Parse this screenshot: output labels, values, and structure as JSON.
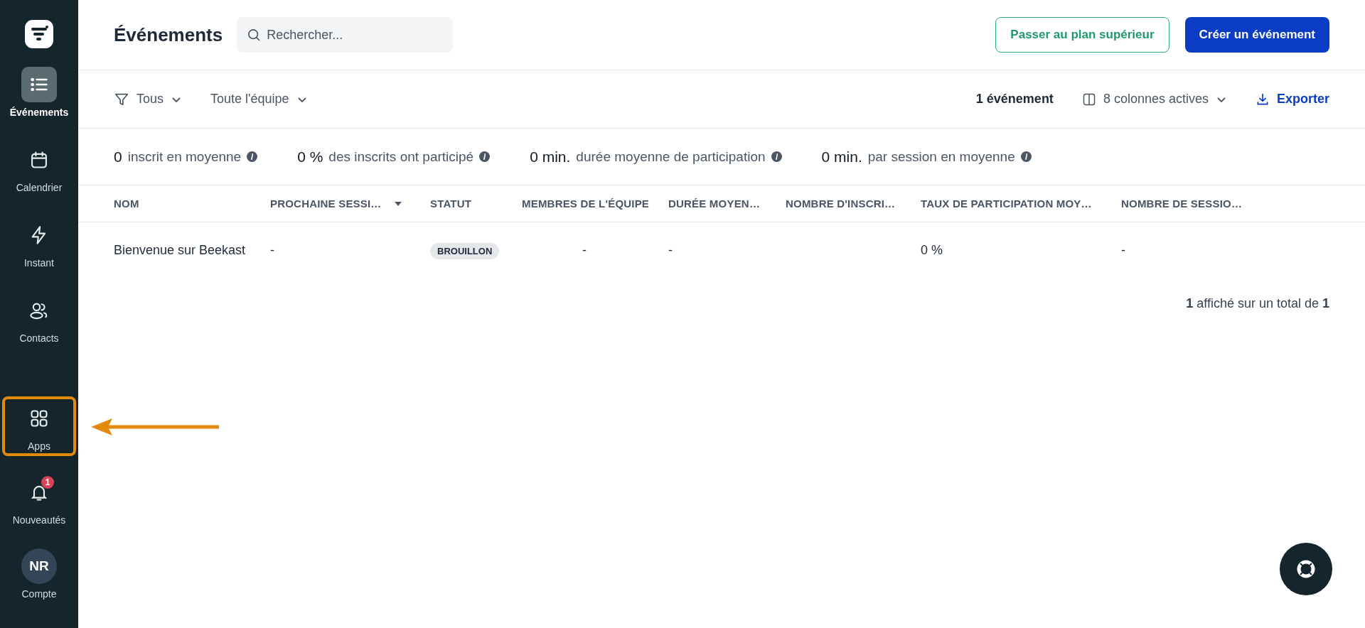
{
  "sidebar": {
    "top_items": [
      {
        "label": "Événements",
        "kind": "nav",
        "selected": true,
        "highlighted": false
      },
      {
        "label": "Calendrier",
        "kind": "nav",
        "selected": false,
        "highlighted": false
      },
      {
        "label": "Instant",
        "kind": "nav",
        "selected": false,
        "highlighted": false
      },
      {
        "label": "Contacts",
        "kind": "nav",
        "selected": false,
        "highlighted": false
      }
    ],
    "bottom_items": [
      {
        "label": "Apps",
        "kind": "nav",
        "selected": false,
        "highlighted": true
      },
      {
        "label": "Nouveautés",
        "kind": "nav",
        "selected": false,
        "highlighted": false,
        "badge": "1"
      },
      {
        "label": "Compte",
        "kind": "avatar",
        "initials": "NR",
        "selected": false,
        "highlighted": false
      }
    ]
  },
  "header": {
    "title": "Événements",
    "search": {
      "placeholder": "Rechercher..."
    },
    "buttons": [
      {
        "label": "Passer au plan supérieur",
        "kind": "outline"
      },
      {
        "label": "Créer un événement",
        "kind": "primary"
      }
    ]
  },
  "filters": {
    "left": [
      {
        "label": "Tous",
        "kind": "filter"
      },
      {
        "label": "Toute l'équipe",
        "kind": "plain"
      }
    ],
    "count": "1 événement",
    "columns_menu": "8 colonnes actives",
    "export": "Exporter"
  },
  "stats": [
    {
      "value": "0",
      "label": "inscrit en moyenne"
    },
    {
      "value": "0 %",
      "label": "des inscrits ont participé"
    },
    {
      "value": "0 min.",
      "label": "durée moyenne de participation"
    },
    {
      "value": "0 min.",
      "label": "par session en moyenne"
    }
  ],
  "table": {
    "columns": [
      {
        "label": "NOM",
        "sorted": false
      },
      {
        "label": "PROCHAINE SESSI…",
        "sorted": true
      },
      {
        "label": "STATUT",
        "sorted": false
      },
      {
        "label": "MEMBRES DE L'ÉQUIPE",
        "sorted": false
      },
      {
        "label": "DURÉE MOYEN…",
        "sorted": false
      },
      {
        "label": "NOMBRE D'INSCRI…",
        "sorted": false
      },
      {
        "label": "TAUX DE PARTICIPATION MOY…",
        "sorted": false
      },
      {
        "label": "NOMBRE DE SESSIO…",
        "sorted": false
      }
    ],
    "rows": [
      {
        "cells": [
          {
            "kind": "text",
            "text": "Bienvenue sur Beekast"
          },
          {
            "kind": "text",
            "text": "-"
          },
          {
            "kind": "badge",
            "text": "BROUILLON"
          },
          {
            "kind": "center",
            "text": "-"
          },
          {
            "kind": "text",
            "text": "-"
          },
          {
            "kind": "empty"
          },
          {
            "kind": "text",
            "text": "0 %"
          },
          {
            "kind": "text",
            "text": "-"
          }
        ]
      }
    ],
    "footer": "**1** affiché sur un total de **1**"
  }
}
